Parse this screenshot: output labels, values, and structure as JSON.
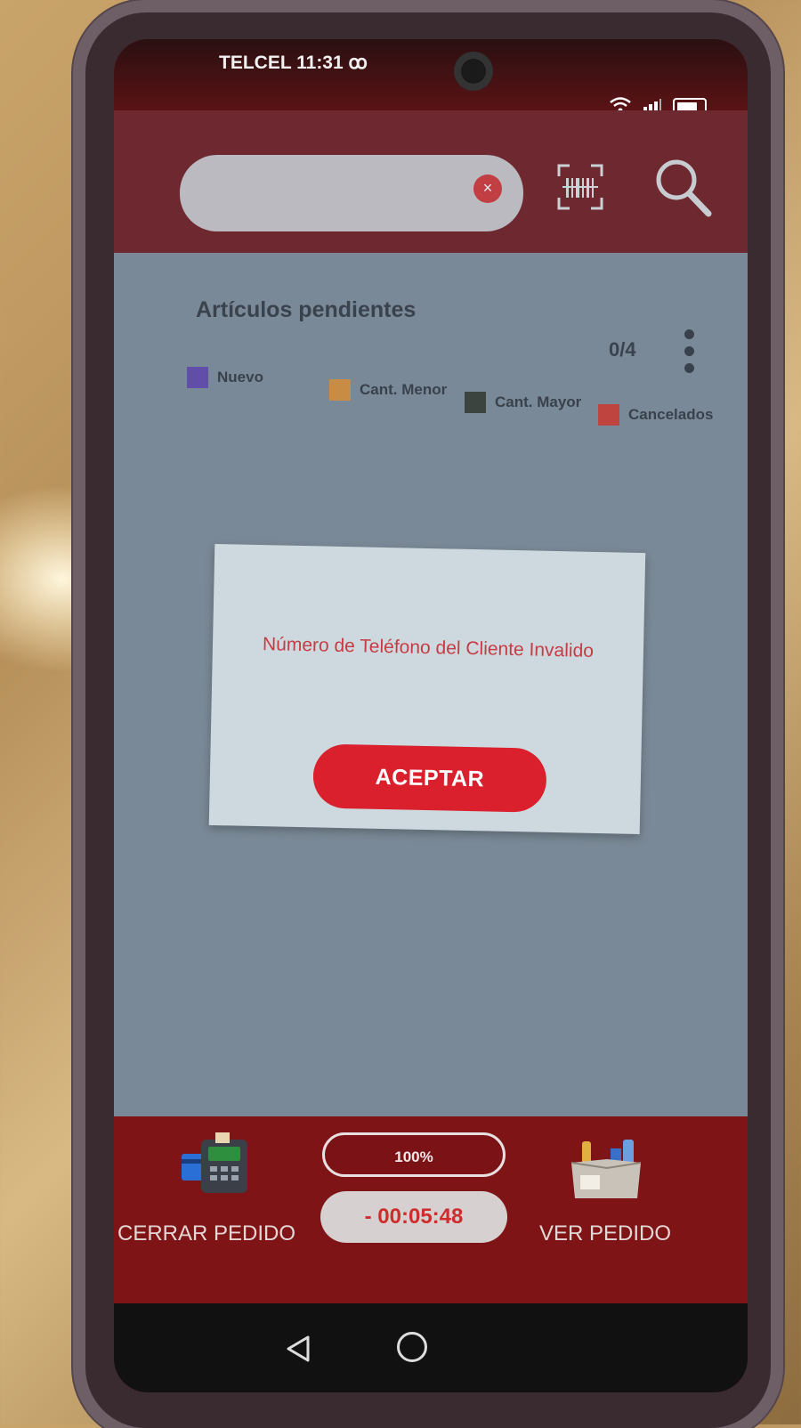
{
  "status_bar": {
    "carrier_time": "TELCEL 11:31 ꝏ",
    "icons": [
      "wifi-icon",
      "signal-icon",
      "battery-icon"
    ]
  },
  "toolbar": {
    "search": {
      "value": "",
      "placeholder": ""
    },
    "clear_icon": "close-icon",
    "barcode_icon": "barcode-scan-icon",
    "search_icon": "search-icon"
  },
  "main": {
    "section_title": "Artículos pendientes",
    "count": "0/4",
    "legend": [
      {
        "label": "Nuevo",
        "color": "#5b3fa7"
      },
      {
        "label": "Cant. Menor",
        "color": "#d98a2e"
      },
      {
        "label": "Cant. Mayor",
        "color": "#2f3327"
      },
      {
        "label": "Cancelados",
        "color": "#cf3327"
      }
    ]
  },
  "dialog": {
    "message": "Número de Teléfono del Cliente Invalido",
    "accept_label": "ACEPTAR"
  },
  "bottom_bar": {
    "close_order_label": "CERRAR PEDIDO",
    "progress_text": "100%",
    "timer": "- 00:05:48",
    "view_order_label": "VER PEDIDO"
  },
  "colors": {
    "brand_red": "#7e1416",
    "accent_red": "#d9202c"
  }
}
